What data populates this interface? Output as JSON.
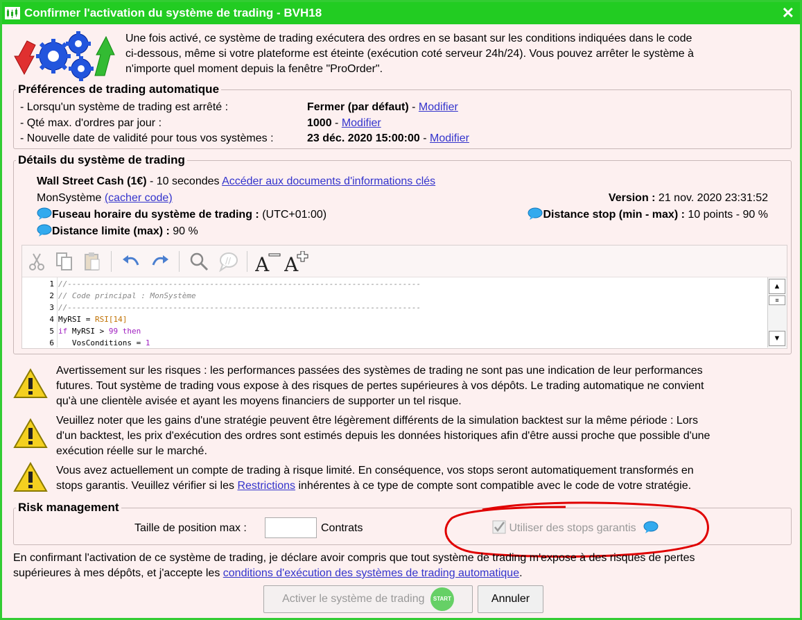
{
  "window": {
    "title": "Confirmer l'activation du système de trading - BVH18",
    "close": "✕"
  },
  "intro": {
    "line1": "Une fois activé, ce système de trading exécutera des ordres en se basant sur les conditions indiquées dans le code",
    "line2": "ci-dessous, même si votre plateforme est éteinte (exécution coté serveur 24h/24). Vous pouvez arrêter le système à",
    "line3": "n'importe quel moment depuis la fenêtre \"ProOrder\"."
  },
  "prefs": {
    "legend": "Préférences de trading automatique",
    "rows": [
      {
        "label": "- Lorsqu'un système de trading est arrêté :",
        "value": "Fermer (par défaut)",
        "sep": " - ",
        "link": "Modifier"
      },
      {
        "label": "- Qté max. d'ordres par jour :",
        "value": "1000",
        "sep": " - ",
        "link": "Modifier"
      },
      {
        "label": "- Nouvelle date de validité pour tous vos systèmes :",
        "value": "23 déc. 2020 15:00:00",
        "sep": " - ",
        "link": "Modifier"
      }
    ]
  },
  "details": {
    "legend": "Détails du système de trading",
    "instrument": "Wall Street Cash (1€)",
    "interval": " - 10 secondes",
    "kid_link": "Accéder aux documents d'informations clés",
    "system_name": "MonSystème",
    "hide_code": "(cacher code)",
    "version_label": "Version :",
    "version_value": " 21 nov. 2020 23:31:52",
    "tz_label": "Fuseau horaire du système de trading :",
    "tz_value": " (UTC+01:00)",
    "stop_label": "Distance stop (min - max) :",
    "stop_value": " 10 points - 90 %",
    "limit_label": "Distance limite (max) :",
    "limit_value": " 90 %"
  },
  "code": {
    "lines": [
      {
        "n": "1",
        "text": "//-----------------------------------------------------------------------------"
      },
      {
        "n": "2",
        "text": "// Code principal : MonSystème"
      },
      {
        "n": "3",
        "text": "//-----------------------------------------------------------------------------"
      },
      {
        "n": "4",
        "a": "MyRSI = ",
        "b": "RSI",
        "c": "[14]"
      },
      {
        "n": "5",
        "a": "if",
        "b": " MyRSI > ",
        "c": "99",
        "d": " then"
      },
      {
        "n": "6",
        "a": "   VosConditions = ",
        "b": "1"
      }
    ]
  },
  "warnings": [
    {
      "l1": "Avertissement sur les risques : les performances passées des systèmes de trading ne sont pas une indication de leur performances",
      "l2": "futures. Tout système de trading vous expose à des risques de pertes supérieures à vos dépôts. Le trading automatique ne convient",
      "l3": "qu'à une clientèle avisée et ayant les moyens financiers de supporter un tel risque."
    },
    {
      "l1": "Veuillez noter que les gains d'une stratégie peuvent être légèrement différents de la simulation backtest sur la même période : Lors",
      "l2": "d'un backtest, les prix d'exécution des ordres sont estimés depuis les données historiques afin d'être aussi proche que possible d'une",
      "l3": "exécution réelle sur le marché."
    },
    {
      "l1": "Vous avez actuellement un compte de trading à risque limité. En conséquence, vos stops seront automatiquement transformés en",
      "l2a": "stops garantis. Veuillez vérifier si les ",
      "link": "Restrictions",
      "l2b": " inhérentes à ce type de compte sont compatible avec le code de votre stratégie."
    }
  ],
  "risk": {
    "legend": "Risk management",
    "position_label": "Taille de position max :",
    "position_value": "",
    "unit": "Contrats",
    "guaranteed_stops": "Utiliser des stops garantis"
  },
  "confirm": {
    "l1": "En confirmant l'activation de ce système de trading, je déclare avoir compris que tout système de trading m'expose à des risques de pertes",
    "l2a": "supérieures à mes dépôts, et j'accepte les ",
    "link": "conditions d'exécution des systèmes de trading automatique",
    "l2b": "."
  },
  "buttons": {
    "activate": "Activer le système de trading",
    "start_badge": "START",
    "cancel": "Annuler"
  },
  "colors": {
    "title_bar": "#22cc22",
    "background": "#fdf0f0",
    "link": "#3333cc",
    "annotation": "#e00000"
  }
}
